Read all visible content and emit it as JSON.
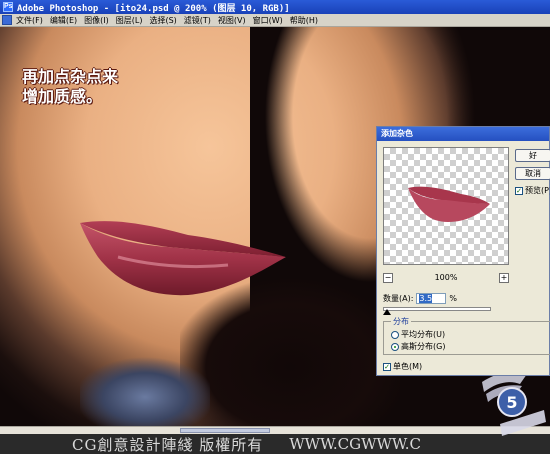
{
  "window": {
    "title": "Adobe Photoshop - [ito24.psd @ 200% (图层 10, RGB)]",
    "app_icon": "Ps"
  },
  "menu": {
    "items": [
      "文件(F)",
      "编辑(E)",
      "图像(I)",
      "图层(L)",
      "选择(S)",
      "滤镜(T)",
      "视图(V)",
      "窗口(W)",
      "帮助(H)"
    ]
  },
  "canvas": {
    "caption_line1": "再加点杂点来",
    "caption_line2": "增加质感。"
  },
  "dialog": {
    "title": "添加杂色",
    "ok_label": "好",
    "cancel_label": "取消",
    "preview_label": "预览(P)",
    "preview_checked": true,
    "zoom": "100%",
    "zoom_out_label": "−",
    "zoom_in_label": "+",
    "amount_label": "数量(A):",
    "amount_value": "3.5",
    "amount_unit": "%",
    "distribution_label": "分布",
    "uniform_label": "平均分布(U)",
    "gaussian_label": "高斯分布(G)",
    "selected_distribution": "gaussian",
    "monochromatic_label": "单色(M)",
    "monochromatic_checked": true
  },
  "footer": {
    "text": "CG創意設計陣綫 版權所有",
    "url": "WWW.CGWWW.C"
  },
  "colors": {
    "titlebar": "#1941b8",
    "menubar": "#d7d3c8",
    "dialog_bg": "#ece9d8",
    "lip_color": "#9b2a3c"
  }
}
